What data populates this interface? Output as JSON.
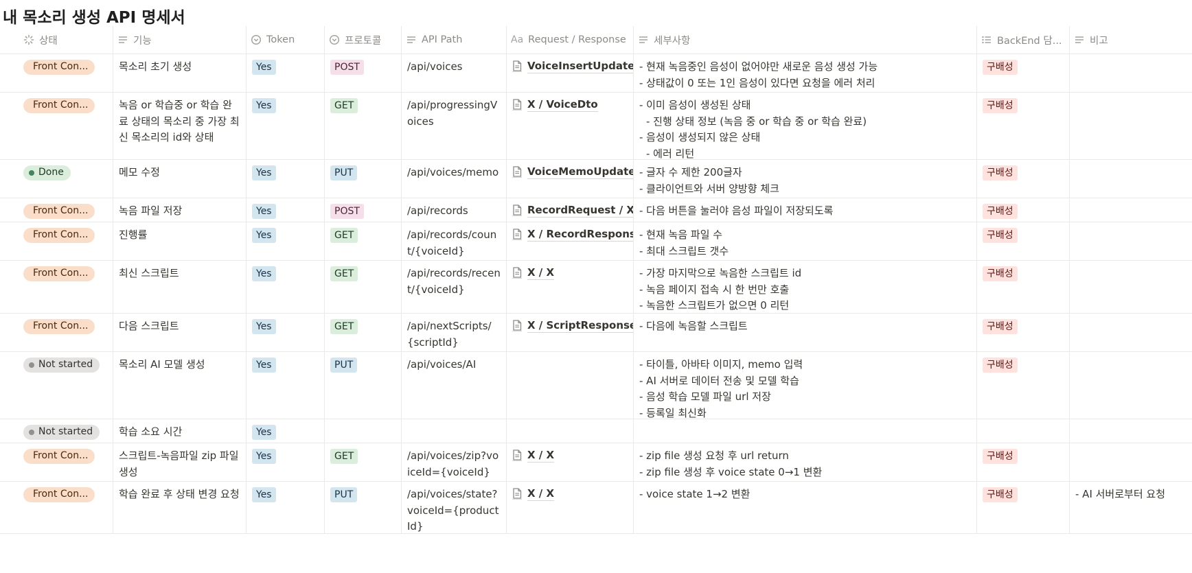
{
  "page": {
    "title": "내 목소리 생성 API 명세서"
  },
  "columns": {
    "status": "상태",
    "feature": "기능",
    "token": "Token",
    "protocol": "프로토콜",
    "path": "API Path",
    "reqres": "Request / Response",
    "detail": "세부사항",
    "backend": "BackEnd 담...",
    "note": "비고"
  },
  "colors": {
    "front_con": "#fadec9",
    "done": "#dbeddb",
    "not_started": "#e3e2e0",
    "yes_tag": "#d3e5ef",
    "backend_tag": "#ffe2dd"
  },
  "rows": [
    {
      "status": "Front Con...",
      "feature": "목소리 초기 생성",
      "token": "Yes",
      "method": "POST",
      "path": "/api/voices",
      "reqres": "VoiceInsertUpdateDto",
      "detail": [
        "- 현재 녹음중인 음성이 없어야만 새로운 음성 생성 가능",
        "- 상태값이 0 또는 1인 음성이 있다면 요청을 에러 처리"
      ],
      "backend": "구배성",
      "note": ""
    },
    {
      "status": "Front Con...",
      "feature": "녹음 or 학습중 or 학습 완료 상태의 목소리 중 가장 최신 목소리의 id와 상태",
      "token": "Yes",
      "method": "GET",
      "path": "/api/progressingVoices",
      "reqres": "X / VoiceDto",
      "detail": [
        "- 이미 음성이 생성된 상태",
        "  - 진행 상태 정보 (녹음 중 or 학습 중 or 학습 완료)",
        "- 음성이 생성되지 않은 상태",
        "  - 에러 리턴"
      ],
      "backend": "구배성",
      "note": ""
    },
    {
      "status": "Done",
      "feature": "메모 수정",
      "token": "Yes",
      "method": "PUT",
      "path": "/api/voices/memo",
      "reqres": "VoiceMemoUpdateRequest",
      "detail": [
        "- 글자 수 제한 200글자",
        "- 클라이언트와 서버 양방향 체크"
      ],
      "backend": "구배성",
      "note": ""
    },
    {
      "status": "Front Con...",
      "feature": "녹음 파일 저장",
      "token": "Yes",
      "method": "POST",
      "path": "/api/records",
      "reqres": "RecordRequest / X",
      "detail": [
        "- 다음 버튼을 눌러야 음성 파일이 저장되도록"
      ],
      "backend": "구배성",
      "note": ""
    },
    {
      "status": "Front Con...",
      "feature": "진행률",
      "token": "Yes",
      "method": "GET",
      "path": "/api/records/count/{voiceId}",
      "reqres": "X / RecordResponse",
      "detail": [
        "- 현재 녹음 파일 수",
        "- 최대 스크립트 갯수"
      ],
      "backend": "구배성",
      "note": ""
    },
    {
      "status": "Front Con...",
      "feature": "최신 스크립트",
      "token": "Yes",
      "method": "GET",
      "path": "/api/records/recent/{voiceId}",
      "reqres": "X / X",
      "detail": [
        "- 가장 마지막으로 녹음한 스크립트 id",
        "- 녹음 페이지 접속 시 한 번만 호출",
        "- 녹음한 스크립트가 없으면 0 리턴"
      ],
      "backend": "구배성",
      "note": ""
    },
    {
      "status": "Front Con...",
      "feature": "다음 스크립트",
      "token": "Yes",
      "method": "GET",
      "path": "/api/nextScripts/{scriptId}",
      "reqres": "X / ScriptResponse",
      "detail": [
        "- 다음에 녹음할 스크립트"
      ],
      "backend": "구배성",
      "note": ""
    },
    {
      "status": "Not started",
      "feature": "목소리 AI 모델 생성",
      "token": "Yes",
      "method": "PUT",
      "path": "/api/voices/AI",
      "reqres": "",
      "detail": [
        "- 타이틀, 아바타 이미지, memo 입력",
        "- AI 서버로 데이터 전송 및 모델 학습",
        "- 음성 학습 모델 파일 url 저장",
        "- 등록일 최신화"
      ],
      "backend": "구배성",
      "note": ""
    },
    {
      "status": "Not started",
      "feature": "학습 소요 시간",
      "token": "Yes",
      "method": "",
      "path": "",
      "reqres": "",
      "detail": [],
      "backend": "",
      "note": ""
    },
    {
      "status": "Front Con...",
      "feature": "스크립트-녹음파일 zip 파일 생성",
      "token": "Yes",
      "method": "GET",
      "path": "/api/voices/zip?voiceId={voiceId}",
      "reqres": "X / X",
      "detail": [
        "- zip file 생성 요청 후 url return",
        "- zip file 생성 후 voice state 0→1 변환"
      ],
      "backend": "구배성",
      "note": ""
    },
    {
      "status": "Front Con...",
      "feature": "학습 완료 후 상태 변경 요청",
      "token": "Yes",
      "method": "PUT",
      "path": "/api/voices/state?voiceId={productId}",
      "reqres": "X / X",
      "detail": [
        "- voice state 1→2 변환"
      ],
      "backend": "구배성",
      "note": "- AI 서버로부터 요청"
    }
  ]
}
